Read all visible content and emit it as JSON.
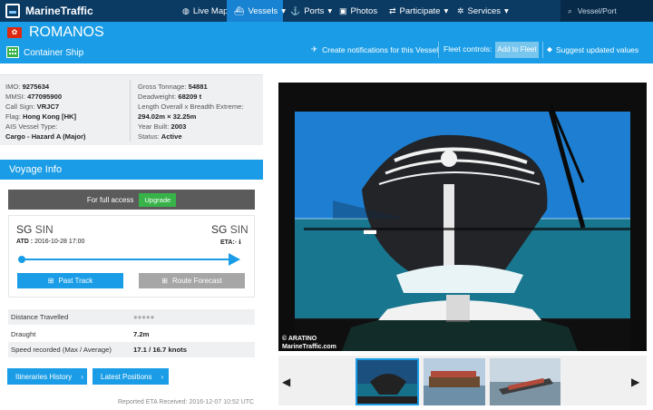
{
  "nav": {
    "brand": "MarineTraffic",
    "items": [
      {
        "label": "Live Map",
        "icon": "globe-icon"
      },
      {
        "label": "Vessels",
        "icon": "ship-icon"
      },
      {
        "label": "Ports",
        "icon": "anchor-icon"
      },
      {
        "label": "Photos",
        "icon": "camera-icon"
      },
      {
        "label": "Participate",
        "icon": "exchange-icon"
      },
      {
        "label": "Services",
        "icon": "gear-icon"
      }
    ],
    "search_placeholder": "Vessel/Port"
  },
  "vessel": {
    "flag_icon": "hong-kong-flag-icon",
    "name": "ROMANOS",
    "type": "Container Ship",
    "notify_label": "Create notifications for this Vessel",
    "fleet_controls_label": "Fleet controls:",
    "add_to_fleet_label": "Add to Fleet",
    "suggest_label": "Suggest updated values"
  },
  "info": {
    "imo_key": "IMO:",
    "imo": "9275634",
    "mmsi_key": "MMSI:",
    "mmsi": "477095900",
    "callsign_key": "Call Sign:",
    "callsign": "VRJC7",
    "flag_key": "Flag:",
    "flag": "Hong Kong [HK]",
    "ais_type_key": "AIS Vessel Type:",
    "ais_type": "Cargo - Hazard A (Major)",
    "gross_key": "Gross Tonnage:",
    "gross": "54881",
    "dwt_key": "Deadweight:",
    "dwt": "68209 t",
    "dims_key": "Length Overall x Breadth Extreme:",
    "dims": "294.02m × 32.25m",
    "year_key": "Year Built:",
    "year": "2003",
    "status_key": "Status:",
    "status": "Active"
  },
  "voyage": {
    "title": "Voyage Info",
    "full_access_text": "For full access",
    "upgrade_label": "Upgrade",
    "from_code": "SG",
    "from_port": "SIN",
    "to_code": "SG",
    "to_port": "SIN",
    "atd_label": "ATD :",
    "atd_value": "2016-10-28 17:00",
    "eta_label": "ETA:",
    "eta_value": "-",
    "past_track_label": "Past Track",
    "route_forecast_label": "Route Forecast",
    "distance_key": "Distance Travelled",
    "distance_value": "●●●●●",
    "draught_key": "Draught",
    "draught_value": "7.2m",
    "speed_key": "Speed recorded (Max / Average)",
    "speed_value": "17.1 / 16.7 knots",
    "itineraries_label": "Itineraries History",
    "latest_positions_label": "Latest Positions",
    "reported_eta": "Reported ETA Received: 2016-12-07 10:52 UTC"
  },
  "photo": {
    "credit_line1": "© ARATINO",
    "credit_line2": "MarineTraffic.com"
  },
  "colors": {
    "topbar": "#0b3a63",
    "accent": "#1a9de6",
    "green": "#37b34a"
  }
}
